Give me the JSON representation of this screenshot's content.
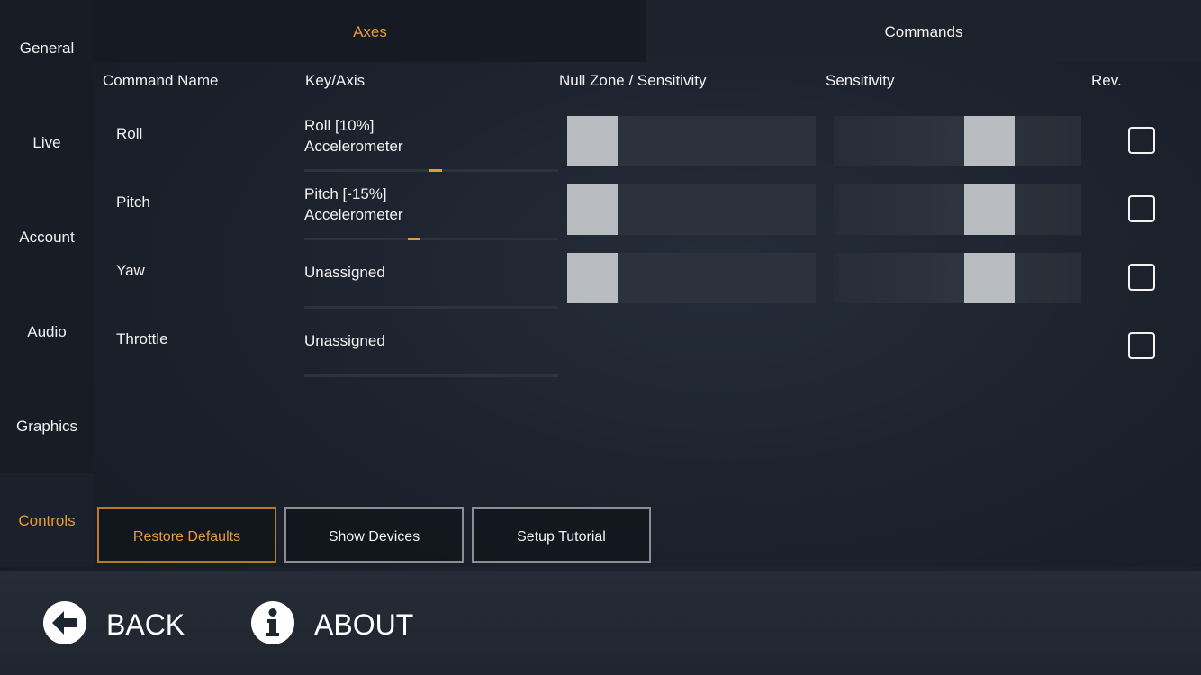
{
  "sidebar": {
    "items": [
      {
        "label": "General"
      },
      {
        "label": "Live"
      },
      {
        "label": "Account"
      },
      {
        "label": "Audio"
      },
      {
        "label": "Graphics"
      },
      {
        "label": "Controls",
        "active": true
      }
    ]
  },
  "tabs": [
    {
      "label": "Axes",
      "active": true
    },
    {
      "label": "Commands",
      "active": false
    }
  ],
  "columns": {
    "command_name": "Command Name",
    "key_axis": "Key/Axis",
    "null_zone": "Null Zone / Sensitivity",
    "sensitivity": "Sensitivity",
    "reverse": "Rev."
  },
  "rows": [
    {
      "name": "Roll",
      "key_line1": "Roll [10%]",
      "key_line2": "Accelerometer",
      "axis_position": 0.52,
      "null_zone": 0.0,
      "sensitivity": 0.66,
      "reversed": false
    },
    {
      "name": "Pitch",
      "key_line1": "Pitch [-15%]",
      "key_line2": "Accelerometer",
      "axis_position": 0.43,
      "null_zone": 0.0,
      "sensitivity": 0.66,
      "reversed": false
    },
    {
      "name": "Yaw",
      "key_line1": "Unassigned",
      "key_line2": "",
      "null_zone": 0.0,
      "sensitivity": 0.66,
      "reversed": false
    },
    {
      "name": "Throttle",
      "key_line1": "Unassigned",
      "key_line2": "",
      "reversed": false
    }
  ],
  "buttons": {
    "restore_defaults": "Restore Defaults",
    "show_devices": "Show Devices",
    "setup_tutorial": "Setup Tutorial"
  },
  "footer": {
    "back_label": "BACK",
    "back_icon": "arrow-left-circle-icon",
    "about_label": "ABOUT",
    "about_icon": "info-circle-icon"
  },
  "colors": {
    "accent": "#e8993a",
    "text": "#f2f2f2",
    "thumb": "#b9bcc0"
  }
}
